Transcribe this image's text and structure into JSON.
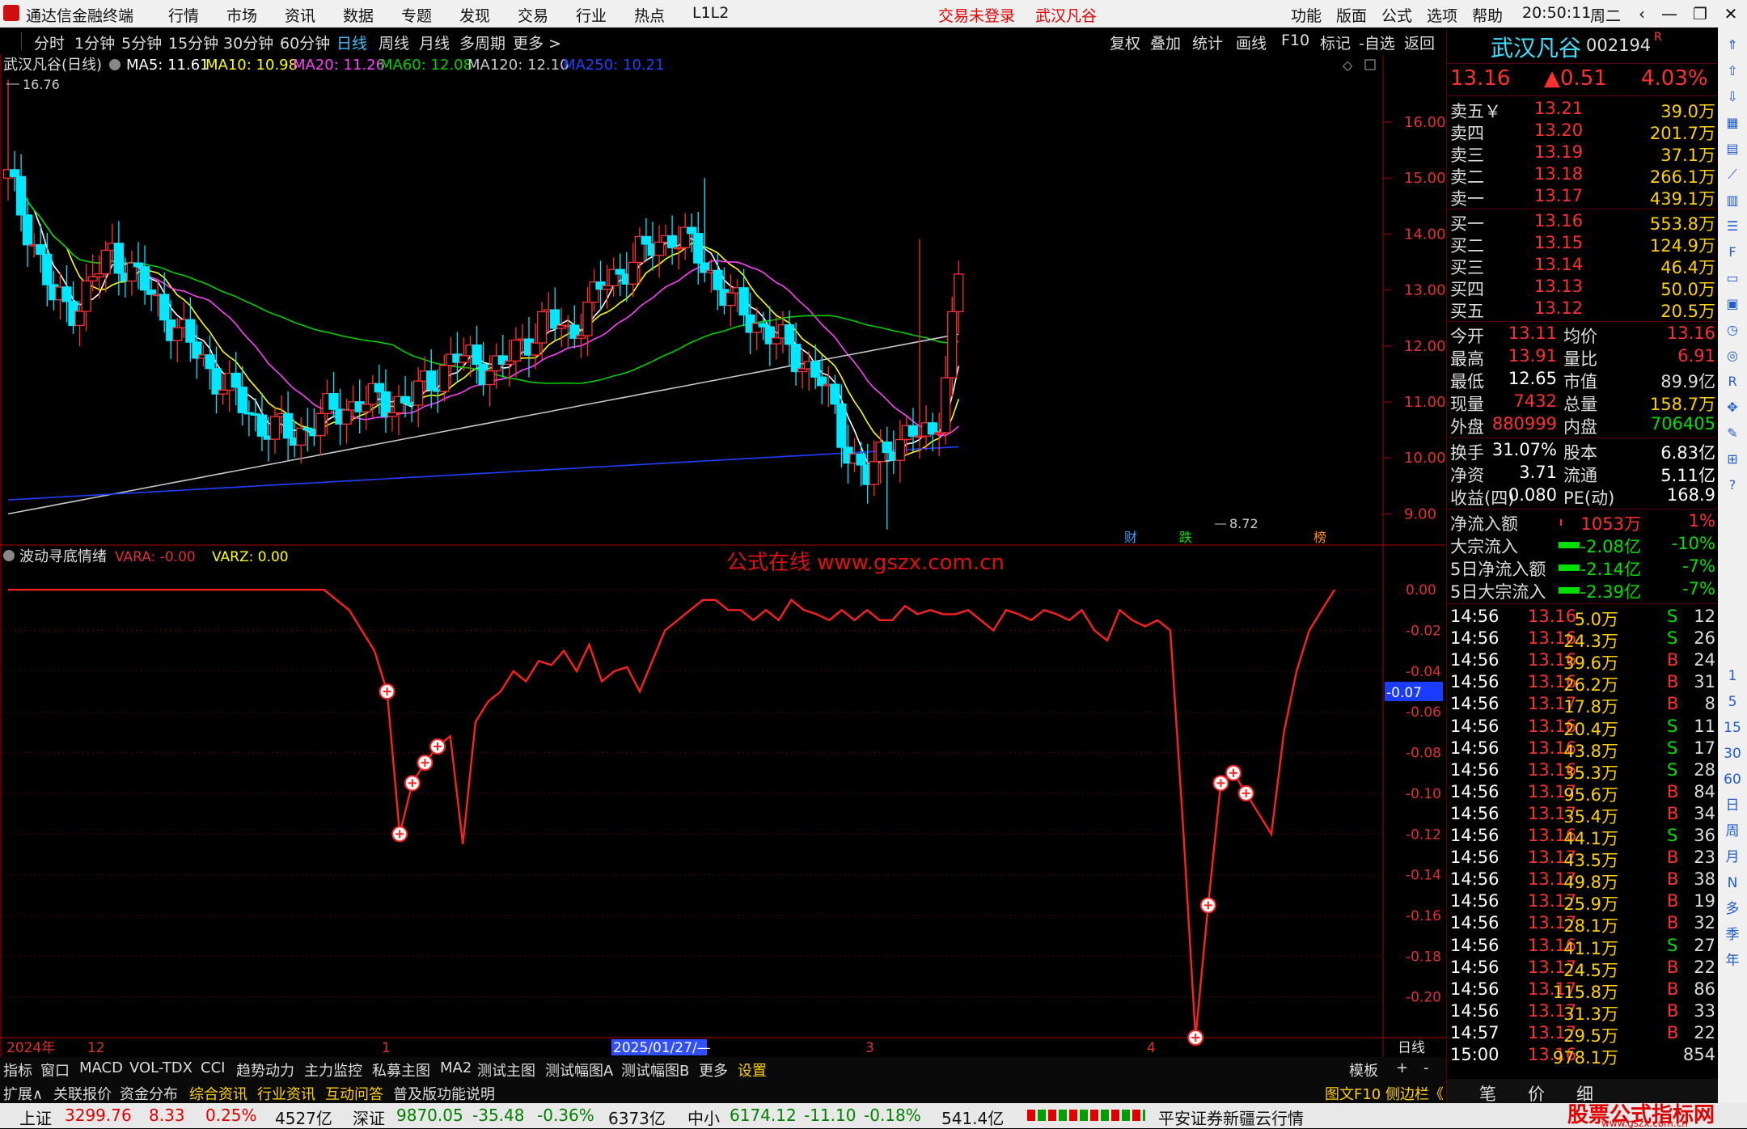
{
  "app": {
    "title": "通达信金融终端",
    "menus": [
      "行情",
      "市场",
      "资讯",
      "数据",
      "专题",
      "发现",
      "交易",
      "行业",
      "热点",
      "L1L2"
    ],
    "login_status": "交易未登录",
    "stock_tag": "武汉凡谷",
    "right_menus": [
      "功能",
      "版面",
      "公式",
      "选项",
      "帮助"
    ],
    "time": "20:50:11",
    "weekday": "周二"
  },
  "toolbar": {
    "periods": [
      "分时",
      "1分钟",
      "5分钟",
      "15分钟",
      "30分钟",
      "60分钟",
      "日线",
      "周线",
      "月线",
      "多周期",
      "更多 >"
    ],
    "active_period": "日线",
    "actions": [
      "复权",
      "叠加",
      "统计",
      "画线",
      "F10",
      "标记",
      "-自选",
      "返回"
    ]
  },
  "chart": {
    "legend_title": "武汉凡谷(日线)",
    "ma": [
      {
        "label": "MA5: 11.61",
        "color": "#ffffff"
      },
      {
        "label": "MA10: 10.98",
        "color": "#ffff00"
      },
      {
        "label": "MA20: 11.26",
        "color": "#ff40ff"
      },
      {
        "label": "MA60: 12.08",
        "color": "#00d000"
      },
      {
        "label": "MA120: 12.10",
        "color": "#c8c8c8"
      },
      {
        "label": "MA250: 10.21",
        "color": "#2040ff"
      }
    ],
    "high_label": "16.76",
    "low_label": "8.72",
    "price_axis": [
      "16.00",
      "15.00",
      "14.00",
      "13.00",
      "12.00",
      "11.00",
      "10.00",
      "9.00"
    ],
    "markers": [
      "财",
      "跌",
      "榜"
    ],
    "indicator_title": "波动寻底情绪",
    "indicator_vara": "VARA: -0.00",
    "indicator_varz": "VARZ: 0.00",
    "watermark": "公式在线 www.gszx.com.cn",
    "ind_axis": [
      "0.00",
      "-0.02",
      "-0.04",
      "-0.06",
      "-0.08",
      "-0.10",
      "-0.12",
      "-0.14",
      "-0.16",
      "-0.18",
      "-0.20"
    ],
    "ind_current": "-0.07",
    "date_labels": [
      "2024年",
      "12",
      "1",
      "2025/01/27/—",
      "3",
      "4"
    ],
    "axis_mode": "日线",
    "chart_data": {
      "type": "candlestick",
      "y_range": [
        8.5,
        17.2
      ],
      "ma_values": {
        "MA5": 11.61,
        "MA10": 10.98,
        "MA20": 11.26,
        "MA60": 12.08,
        "MA120": 12.1,
        "MA250": 10.21
      },
      "indicator": {
        "name": "波动寻底情绪",
        "y_range": [
          -0.22,
          0.01
        ],
        "values": [
          0,
          0,
          0,
          0,
          0,
          0,
          0,
          0,
          0,
          0,
          0,
          0,
          0,
          0,
          0,
          0,
          0,
          0,
          0,
          0,
          0,
          0,
          0,
          0,
          0,
          0,
          -0.005,
          -0.01,
          -0.02,
          -0.03,
          -0.05,
          -0.12,
          -0.095,
          -0.085,
          -0.077,
          -0.072,
          -0.125,
          -0.065,
          -0.055,
          -0.05,
          -0.04,
          -0.045,
          -0.035,
          -0.037,
          -0.03,
          -0.04,
          -0.027,
          -0.045,
          -0.04,
          -0.038,
          -0.05,
          -0.035,
          -0.02,
          -0.015,
          -0.01,
          -0.005,
          -0.005,
          -0.01,
          -0.01,
          -0.015,
          -0.01,
          -0.015,
          -0.005,
          -0.01,
          -0.012,
          -0.015,
          -0.01,
          -0.015,
          -0.01,
          -0.015,
          -0.015,
          -0.008,
          -0.012,
          -0.01,
          -0.012,
          -0.012,
          -0.01,
          -0.015,
          -0.02,
          -0.01,
          -0.012,
          -0.015,
          -0.01,
          -0.012,
          -0.015,
          -0.01,
          -0.02,
          -0.025,
          -0.01,
          -0.015,
          -0.018,
          -0.015,
          -0.02,
          -0.115,
          -0.22,
          -0.155,
          -0.095,
          -0.09,
          -0.1,
          -0.11,
          -0.12,
          -0.07,
          -0.04,
          -0.02,
          -0.01,
          0
        ]
      }
    }
  },
  "tabs1": [
    "指标",
    "窗口",
    "MACD",
    "VOL-TDX",
    "CCI",
    "趋势动力",
    "主力监控",
    "私募主图",
    "MA2",
    "测试主图",
    "测试幅图A",
    "测试幅图B",
    "更多",
    "设置"
  ],
  "tabs1_right": [
    "模板",
    "+",
    "-"
  ],
  "tabs2": [
    "扩展∧",
    "关联报价",
    "资金分布",
    "综合资讯",
    "行业资讯",
    "互动问答",
    "普及版功能说明"
  ],
  "tabs2_right": "图文F10 侧边栏《",
  "quote": {
    "name": "武汉凡谷",
    "code": "002194",
    "flag": "R",
    "price": "13.16",
    "change": "▲0.51",
    "pct": "4.03%",
    "asks": [
      [
        "卖五￥",
        "13.21",
        "39.0万"
      ],
      [
        "卖四",
        "13.20",
        "201.7万"
      ],
      [
        "卖三",
        "13.19",
        "37.1万"
      ],
      [
        "卖二",
        "13.18",
        "266.1万"
      ],
      [
        "卖一",
        "13.17",
        "439.1万"
      ]
    ],
    "bids": [
      [
        "买一",
        "13.16",
        "553.8万"
      ],
      [
        "买二",
        "13.15",
        "124.9万"
      ],
      [
        "买三",
        "13.14",
        "46.4万"
      ],
      [
        "买四",
        "13.13",
        "50.0万"
      ],
      [
        "买五",
        "13.12",
        "20.5万"
      ]
    ],
    "stats": [
      [
        "今开",
        "13.11",
        "均价",
        "13.16"
      ],
      [
        "最高",
        "13.91",
        "量比",
        "6.91"
      ],
      [
        "最低",
        "12.65",
        "市值",
        "89.9亿"
      ],
      [
        "现量",
        "7432",
        "总量",
        "158.7万"
      ],
      [
        "外盘",
        "880999",
        "内盘",
        "706405"
      ]
    ],
    "fin": [
      [
        "换手",
        "31.07%",
        "股本",
        "6.83亿"
      ],
      [
        "净资",
        "3.71",
        "流通",
        "5.11亿"
      ],
      [
        "收益(四)",
        "0.080",
        "PE(动)",
        "168.9"
      ]
    ],
    "flows": [
      [
        "净流入额",
        "1053万",
        "1%"
      ],
      [
        "大宗流入",
        "-2.08亿",
        "-10%"
      ],
      [
        "5日净流入额",
        "-2.14亿",
        "-7%"
      ],
      [
        "5日大宗流入",
        "-2.39亿",
        "-7%"
      ]
    ],
    "ticks": [
      [
        "14:56",
        "13.16",
        "5.0万",
        "S",
        "12"
      ],
      [
        "14:56",
        "13.16",
        "24.3万",
        "S",
        "26"
      ],
      [
        "14:56",
        "13.16",
        "39.6万",
        "B",
        "24"
      ],
      [
        "14:56",
        "13.16",
        "26.2万",
        "B",
        "31"
      ],
      [
        "14:56",
        "13.17",
        "17.8万",
        "B",
        "8"
      ],
      [
        "14:56",
        "13.16",
        "20.4万",
        "S",
        "11"
      ],
      [
        "14:56",
        "13.16",
        "43.8万",
        "S",
        "17"
      ],
      [
        "14:56",
        "13.16",
        "35.3万",
        "S",
        "28"
      ],
      [
        "14:56",
        "13.17",
        "95.6万",
        "B",
        "84"
      ],
      [
        "14:56",
        "13.17",
        "35.4万",
        "B",
        "34"
      ],
      [
        "14:56",
        "13.16",
        "44.1万",
        "S",
        "36"
      ],
      [
        "14:56",
        "13.17",
        "43.5万",
        "B",
        "23"
      ],
      [
        "14:56",
        "13.17",
        "49.8万",
        "B",
        "38"
      ],
      [
        "14:56",
        "13.17",
        "25.9万",
        "B",
        "19"
      ],
      [
        "14:56",
        "13.17",
        "28.1万",
        "B",
        "32"
      ],
      [
        "14:56",
        "13.16",
        "41.1万",
        "S",
        "27"
      ],
      [
        "14:56",
        "13.17",
        "24.5万",
        "B",
        "22"
      ],
      [
        "14:56",
        "13.17",
        "115.8万",
        "B",
        "86"
      ],
      [
        "14:56",
        "13.17",
        "31.3万",
        "B",
        "33"
      ],
      [
        "14:57",
        "13.17",
        "29.5万",
        "B",
        "22"
      ],
      [
        "15:00",
        "13.16",
        "978.1万",
        "",
        "854"
      ]
    ],
    "bottom_tabs": [
      "笔",
      "价",
      "细"
    ]
  },
  "status": {
    "sh_label": "上证",
    "sh_val": "3299.76",
    "sh_chg": "8.33",
    "sh_pct": "0.25%",
    "sh_amt": "4527亿",
    "sz_label": "深证",
    "sz_val": "9870.05",
    "sz_chg": "-35.48",
    "sz_pct": "-0.36%",
    "sz_amt": "6373亿",
    "zx_label": "中小",
    "zx_val": "6174.12",
    "zx_chg": "-11.10",
    "zx_pct": "-0.18%",
    "zx_amt": "541.4亿",
    "broker": "平安证券新疆云行情",
    "logo": "股票公式指标网",
    "logo_url": "www.gszx.com.cn"
  },
  "side_icons": [
    "up-arrow-icon",
    "up-icon",
    "down-icon",
    "grid-icon",
    "table-icon",
    "line-chart-icon",
    "bar-chart-icon",
    "list-icon",
    "f10-icon",
    "document-icon",
    "fs-icon",
    "clock-icon",
    "chart-icon",
    "rsi-icon",
    "move-icon",
    "pen-icon",
    "fs2-icon",
    "help-icon"
  ],
  "side_labels": [
    "1",
    "5",
    "15",
    "30",
    "60",
    "日",
    "周",
    "月",
    "N",
    "多",
    "季",
    "年"
  ]
}
